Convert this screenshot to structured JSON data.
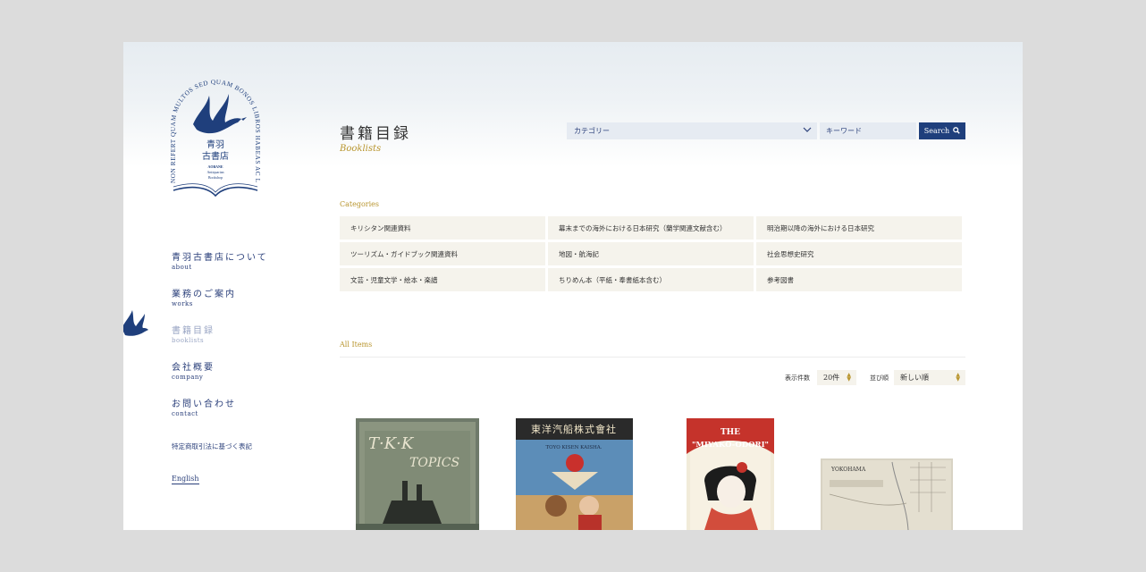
{
  "logo": {
    "circle_text": "NON REFERT QUAM MULTOS SED QUAM BONOS LIBROS HABEAS AC LEGAS.",
    "name_line1": "青羽",
    "name_line2": "古書店",
    "en_line1": "AOBANE",
    "en_line2": "Antiquarian",
    "en_line3": "Bookshop"
  },
  "nav": {
    "items": [
      {
        "jp": "青羽古書店について",
        "en": "about"
      },
      {
        "jp": "業務のご案内",
        "en": "works"
      },
      {
        "jp": "書籍目録",
        "en": "booklists"
      },
      {
        "jp": "会社概要",
        "en": "company"
      },
      {
        "jp": "お問い合わせ",
        "en": "contact"
      }
    ],
    "legal": "特定商取引法に基づく表記",
    "english": "English"
  },
  "header": {
    "title_jp": "書籍目録",
    "title_en": "Booklists"
  },
  "search": {
    "category_placeholder": "カテゴリー",
    "keyword_placeholder": "キーワード",
    "button_label": "Search"
  },
  "categories": {
    "heading": "Categories",
    "items": [
      "キリシタン関連資料",
      "幕末までの海外における日本研究（蘭学関連文献含む）",
      "明治期以降の海外における日本研究",
      "ツーリズム・ガイドブック関連資料",
      "地図・航海記",
      "社会思想史研究",
      "文芸・児童文学・絵本・楽譜",
      "ちりめん本（平紙・奉書紙本含む）",
      "参考図書"
    ]
  },
  "all_items": {
    "heading": "All Items",
    "per_page_label": "表示件数",
    "per_page_value": "20件",
    "sort_label": "並び順",
    "sort_value": "新しい順"
  },
  "products": {
    "p1": {
      "title_line1": "T·K·K",
      "title_line2": "TOPICS"
    },
    "p2": {
      "banner": "東洋汽船株式會社",
      "subtitle": "TOYO KISEN KAISHA."
    },
    "p3": {
      "title_line1": "THE",
      "title_line2": "\"MIYAKO-ODORI\""
    },
    "p4": {
      "title": "YOKOHAMA"
    }
  },
  "colors": {
    "brand_navy": "#1f3f7c",
    "accent_gold": "#b8952e",
    "cell_bg": "#f5f3ec",
    "input_bg": "#e6ebf2"
  }
}
